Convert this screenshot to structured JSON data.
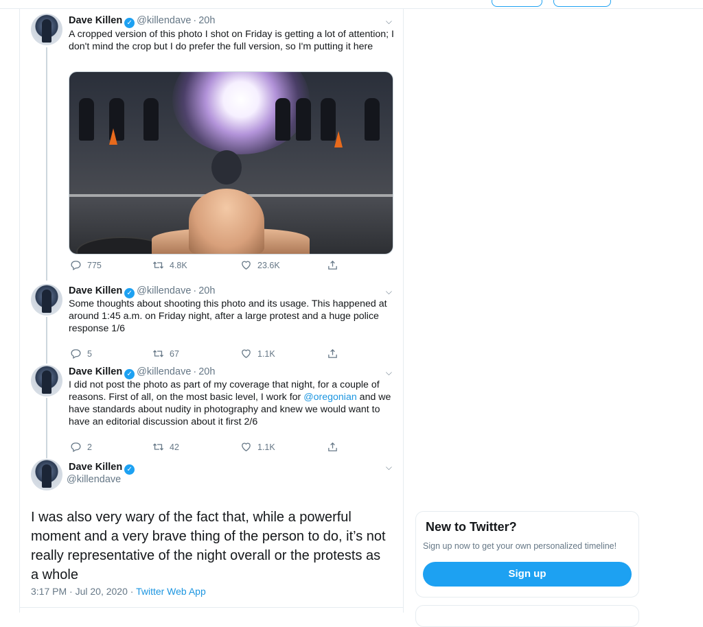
{
  "author": {
    "name": "Dave Killen",
    "handle": "@killendave",
    "time": "20h"
  },
  "tweets": [
    {
      "text_parts": [
        "A cropped version of this photo I shot on Friday is getting a lot of attention; I don't mind the crop but I do prefer the full version, so I'm putting it here"
      ],
      "replies": "775",
      "retweets": "4.8K",
      "likes": "23.6K"
    },
    {
      "text_parts": [
        "Some thoughts about shooting this photo and its usage.  This happened at around 1:45 a.m. on Friday night, after a large protest and a huge police response 1/6"
      ],
      "replies": "5",
      "retweets": "67",
      "likes": "1.1K"
    },
    {
      "text_before": "I did not post the photo as part of my coverage that night, for a couple of reasons. First of all, on the most basic level, I work for ",
      "mention": "@oregonian",
      "text_after": " and we have standards about nudity in photography and knew we would want to have an editorial discussion about it first 2/6",
      "replies": "2",
      "retweets": "42",
      "likes": "1.1K"
    }
  ],
  "detail": {
    "text": "I was also very wary of the fact that, while a powerful moment and a very brave thing of the person to do, it’s not really representative of the night overall or the protests as a whole",
    "timestamp": "3:17 PM · Jul 20, 2020 · ",
    "app": "Twitter Web App"
  },
  "sidebar": {
    "title": "New to Twitter?",
    "subtitle": "Sign up now to get your own personalized timeline!",
    "signup_label": "Sign up"
  },
  "icons": {
    "verified": "verified-badge-icon",
    "reply": "reply-icon",
    "retweet": "retweet-icon",
    "like": "heart-icon",
    "share": "share-icon",
    "caret": "chevron-down-icon"
  },
  "colors": {
    "accent": "#1da1f2",
    "link": "#1b95e0",
    "muted": "#657786"
  }
}
